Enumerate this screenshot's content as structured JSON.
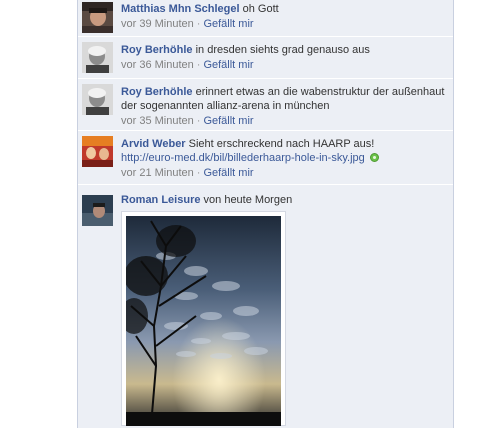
{
  "comments": [
    {
      "author": "Matthias Mhn Schlegel",
      "text": "oh Gott",
      "time": "vor 39 Minuten",
      "like": "Gefällt mir"
    },
    {
      "author": "Roy Berhöhle",
      "text": "in dresden siehts grad genauso aus",
      "time": "vor 36 Minuten",
      "like": "Gefällt mir"
    },
    {
      "author": "Roy Berhöhle",
      "text_line1": "erinnert etwas an die wabenstruktur der außenhaut",
      "text_line2": "der sogenannten allianz-arena in münchen",
      "time": "vor 35 Minuten",
      "like": "Gefällt mir"
    },
    {
      "author": "Arvid Weber",
      "text": "Sieht erschreckend nach HAARP aus!",
      "link": "http://euro-med.dk/bil/billederhaarp-hole-in-sky.jpg",
      "time": "vor 21 Minuten",
      "like": "Gefällt mir"
    },
    {
      "author": "Roman Leisure",
      "text": "von heute Morgen"
    }
  ],
  "separator": "·",
  "colors": {
    "feed_bg": "#eceff5",
    "link_blue": "#3b5998",
    "meta_gray": "#808080",
    "external_link_icon": "#6bc24a"
  },
  "icons": {
    "external_link": "external-link-icon"
  }
}
